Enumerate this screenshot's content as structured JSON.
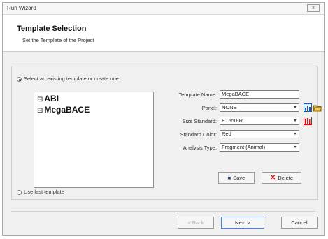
{
  "window": {
    "title": "Run Wizard",
    "close": "x"
  },
  "header": {
    "title": "Template Selection",
    "subtitle": "Set the Template of the Project"
  },
  "options": {
    "select_existing": "Select an existing template or create one",
    "use_last": "Use last template"
  },
  "templates": [
    "ABI",
    "MegaBACE"
  ],
  "form": {
    "template_name_label": "Template Name:",
    "template_name_value": "MegaBACE",
    "panel_label": "Panel:",
    "panel_value": "NONE",
    "size_standard_label": "Size Standard:",
    "size_standard_value": "ET550-R",
    "standard_color_label": "Standard Color:",
    "standard_color_value": "Red",
    "analysis_type_label": "Analysis Type:",
    "analysis_type_value": "Fragment (Animal)"
  },
  "actions": {
    "save": "Save",
    "delete": "Delete"
  },
  "footer": {
    "back": "< Back",
    "next": "Next >",
    "cancel": "Cancel"
  },
  "colors": {
    "accent_blue": "#1e5aa8",
    "red": "#d21b1b"
  },
  "icons": {
    "panel_chart": "bar-chart-icon",
    "panel_open": "folder-open-icon",
    "size_standard": "size-standard-icon",
    "save": "save-disk-icon",
    "delete": "delete-x-icon"
  }
}
